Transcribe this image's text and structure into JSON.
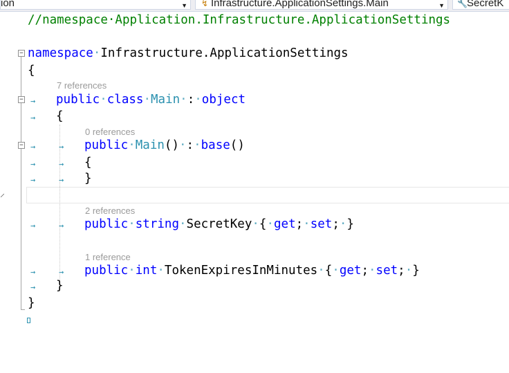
{
  "navbar": {
    "project_dropdown": "ion",
    "type_dropdown": "Infrastructure.ApplicationSettings.Main",
    "member_dropdown": "SecretK"
  },
  "icons": {
    "type": "class-icon",
    "member": "wrench-icon"
  },
  "colors": {
    "keyword": "#0000ff",
    "type": "#2b91af",
    "comment": "#008000",
    "codelens": "#9a9a9a"
  },
  "code": {
    "comment_line": "//namespace·Application.Infrastructure.ApplicationSettings",
    "namespace_keyword": "namespace",
    "namespace_name": "Infrastructure.ApplicationSettings",
    "open_brace": "{",
    "close_brace": "}",
    "codelens_class": "7 references",
    "class_public": "public",
    "class_keyword": "class",
    "class_name": "Main",
    "class_colon": ":",
    "class_base": "object",
    "codelens_ctor": "0 references",
    "ctor_public": "public",
    "ctor_name": "Main",
    "ctor_parens": "()",
    "ctor_colon": ":",
    "ctor_base": "base",
    "ctor_base_parens": "()",
    "codelens_secret": "2 references",
    "secret_public": "public",
    "secret_type": "string",
    "secret_name": "SecretKey",
    "codelens_token": "1 reference",
    "token_public": "public",
    "token_type": "int",
    "token_name": "TokenExpiresInMinutes",
    "accessor_open": "{",
    "accessor_get": "get",
    "accessor_set": "set",
    "accessor_close": "}",
    "semicolon": ";"
  }
}
